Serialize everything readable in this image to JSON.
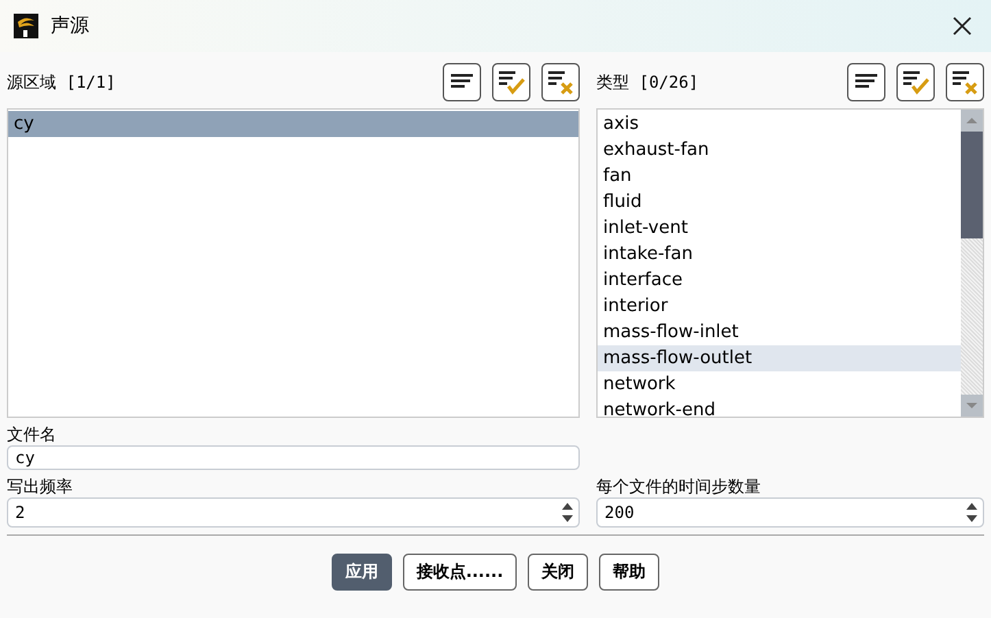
{
  "window": {
    "title": "声源"
  },
  "source_zones": {
    "label": "源区域 [1/1]",
    "items": [
      {
        "label": "cy",
        "selected": true
      }
    ]
  },
  "types": {
    "label": "类型 [0/26]",
    "items": [
      {
        "label": "axis",
        "selected": false,
        "highlighted": false
      },
      {
        "label": "exhaust-fan",
        "selected": false,
        "highlighted": false
      },
      {
        "label": "fan",
        "selected": false,
        "highlighted": false
      },
      {
        "label": "fluid",
        "selected": false,
        "highlighted": false
      },
      {
        "label": "inlet-vent",
        "selected": false,
        "highlighted": false
      },
      {
        "label": "intake-fan",
        "selected": false,
        "highlighted": false
      },
      {
        "label": "interface",
        "selected": false,
        "highlighted": false
      },
      {
        "label": "interior",
        "selected": false,
        "highlighted": false
      },
      {
        "label": "mass-flow-inlet",
        "selected": false,
        "highlighted": false
      },
      {
        "label": "mass-flow-outlet",
        "selected": false,
        "highlighted": true
      },
      {
        "label": "network",
        "selected": false,
        "highlighted": false
      },
      {
        "label": "network-end",
        "selected": false,
        "highlighted": false
      }
    ]
  },
  "file_name": {
    "label": "文件名",
    "value": "cy"
  },
  "write_frequency": {
    "label": "写出频率",
    "value": "2"
  },
  "time_steps_per_file": {
    "label": "每个文件的时间步数量",
    "value": "200"
  },
  "buttons": [
    {
      "label": "应用",
      "primary": true
    },
    {
      "label": "接收点......",
      "primary": false
    },
    {
      "label": "关闭",
      "primary": false
    },
    {
      "label": "帮助",
      "primary": false
    }
  ]
}
